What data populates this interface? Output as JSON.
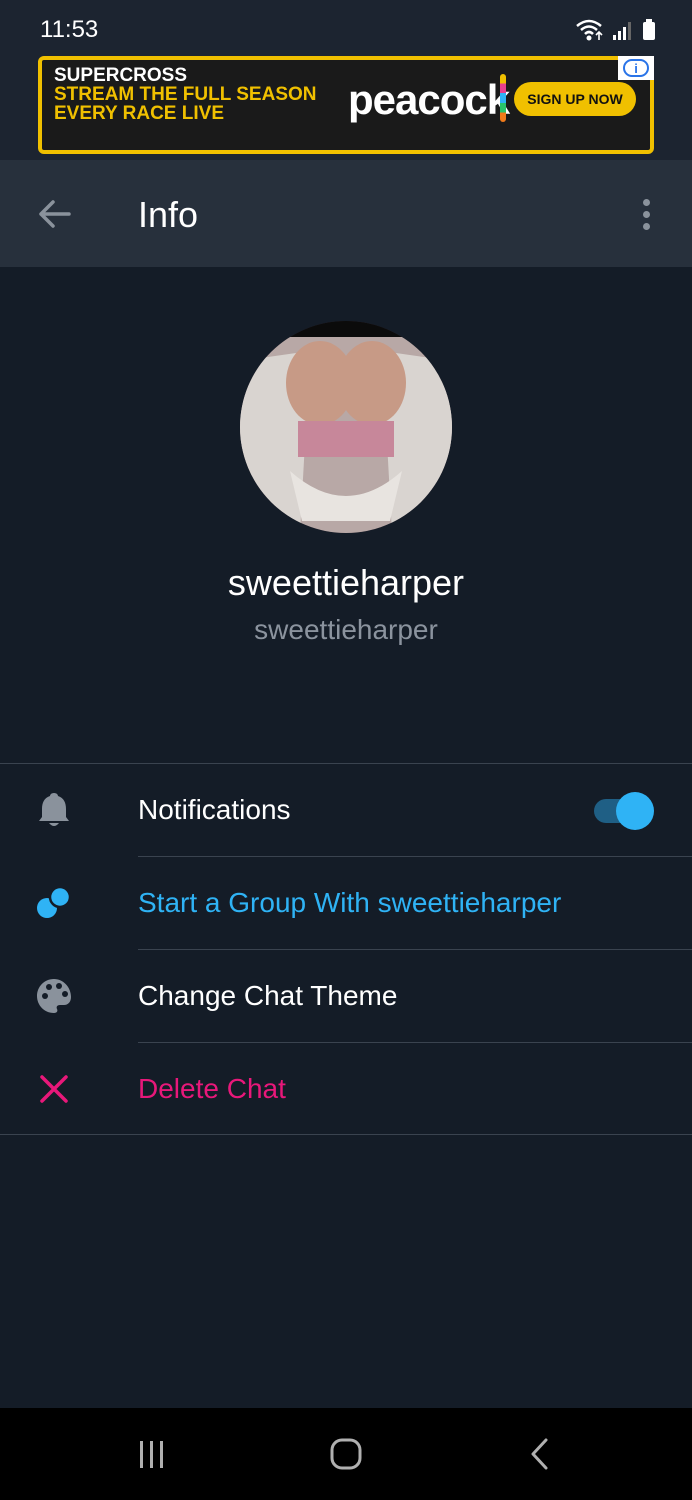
{
  "status_bar": {
    "time": "11:53",
    "icons": [
      "wifi-icon",
      "signal-icon",
      "battery-icon"
    ]
  },
  "ad": {
    "line1": "SUPERCROSS",
    "line2": "STREAM THE FULL SEASON",
    "line3": "EVERY RACE LIVE",
    "brand": "peacock",
    "cta": "SIGN UP NOW",
    "info_glyph": "i"
  },
  "app_bar": {
    "title": "Info"
  },
  "profile": {
    "display_name": "sweettieharper",
    "username": "sweettieharper"
  },
  "options": [
    {
      "label": "Notifications",
      "icon": "bell-icon",
      "color": "#ffffff",
      "toggle_on": true
    },
    {
      "label": "Start a Group With sweettieharper",
      "icon": "group-icon",
      "color": "#2fb3f5"
    },
    {
      "label": "Change Chat Theme",
      "icon": "palette-icon",
      "color": "#ffffff"
    },
    {
      "label": "Delete Chat",
      "icon": "close-icon",
      "color": "#e8187a"
    }
  ],
  "colors": {
    "background": "#141c27",
    "app_bar": "#27303c",
    "accent": "#2fb3f5",
    "danger": "#e8187a"
  }
}
